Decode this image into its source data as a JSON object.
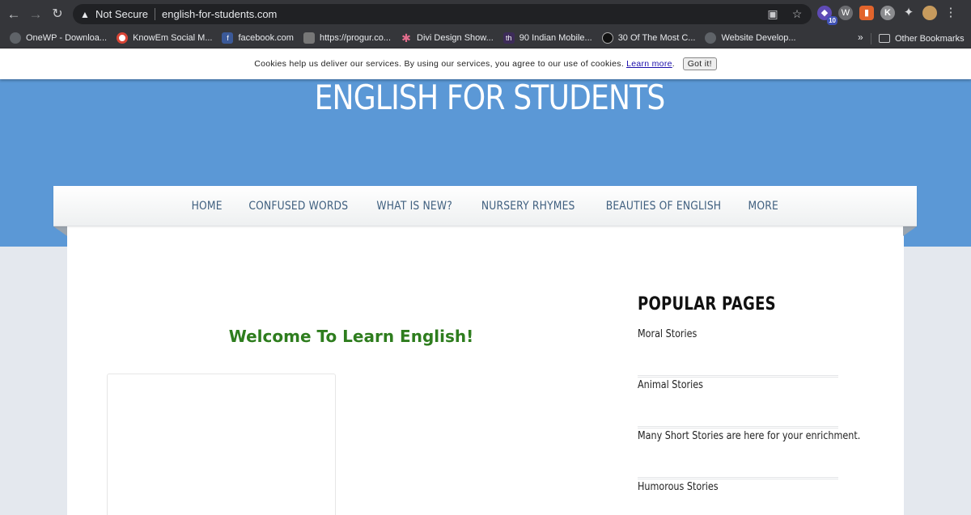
{
  "browser": {
    "security_label": "Not Secure",
    "url": "english-for-students.com",
    "extension_badge": "10",
    "profile_initial": "K",
    "bookmarks": [
      {
        "label": "OneWP - Downloa...",
        "icon": "globe-icon"
      },
      {
        "label": "KnowEm Social M...",
        "icon": "knowem-icon"
      },
      {
        "label": "facebook.com",
        "icon": "facebook-icon"
      },
      {
        "label": "https://progur.co...",
        "icon": "page-icon"
      },
      {
        "label": "Divi Design Show...",
        "icon": "divi-icon"
      },
      {
        "label": "90 Indian Mobile...",
        "icon": "th-icon"
      },
      {
        "label": "30 Of The Most C...",
        "icon": "shield-icon"
      },
      {
        "label": "Website Develop...",
        "icon": "globe-icon"
      }
    ],
    "bookmarks_overflow": "»",
    "other_bookmarks": "Other Bookmarks"
  },
  "cookie_notice": {
    "text": "Cookies help us deliver our services. By using our services, you agree to our use of cookies.",
    "link": "Learn more",
    "period": ".",
    "button": "Got it!"
  },
  "site": {
    "title": "ENGLISH FOR STUDENTS",
    "menu": [
      "HOME",
      "CONFUSED WORDS",
      "WHAT IS NEW?",
      "NURSERY RHYMES",
      "BEAUTIES OF ENGLISH",
      "MORE"
    ],
    "welcome": "Welcome To Learn English!",
    "popular_pages_title": "POPULAR PAGES",
    "popular_pages": [
      "Moral Stories",
      "Animal Stories",
      "Many Short Stories are here for your enrichment.",
      "Humorous Stories"
    ]
  },
  "colors": {
    "header_blue": "#5b98d6",
    "welcome_green": "#2e7d1e",
    "menu_text": "#3f5f7f"
  }
}
